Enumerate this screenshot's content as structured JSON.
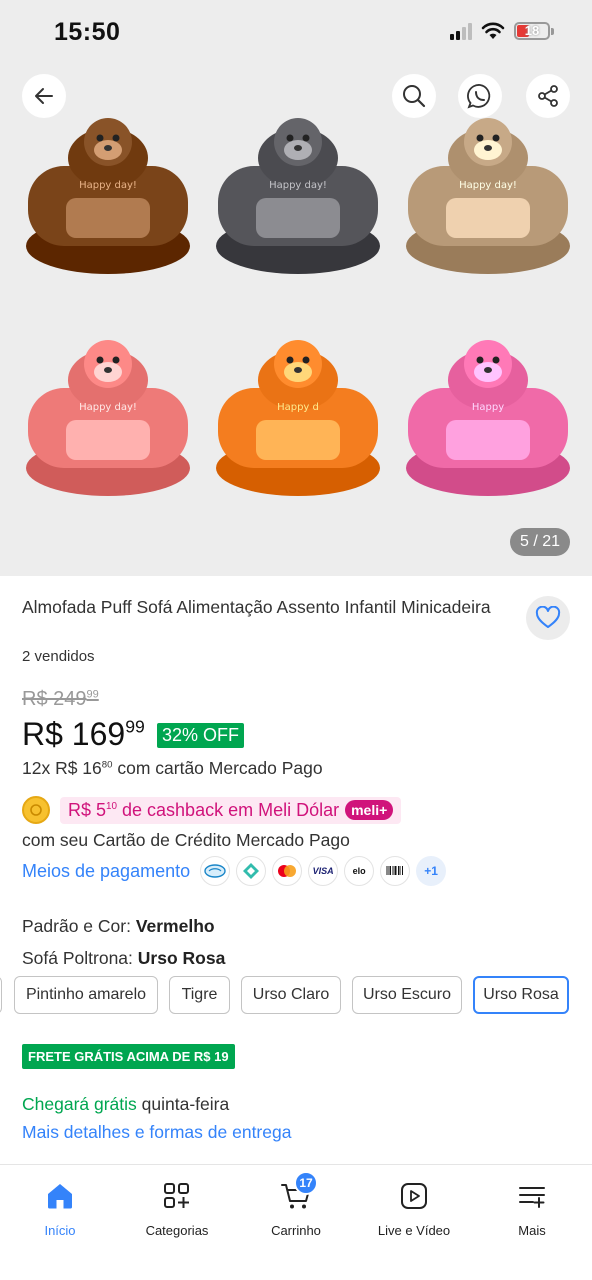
{
  "status_bar": {
    "time": "15:50",
    "battery": "18"
  },
  "gallery": {
    "counter": "5 / 21",
    "seat_colors": [
      "#7a4419",
      "#55555a",
      "#b89a78",
      "#ee7a78",
      "#f47d1f",
      "#f06aa8"
    ],
    "seat_text": [
      "Happy day!",
      "Happy day!",
      "Happy day!",
      "Happy day!",
      "Happy d",
      "Happy"
    ]
  },
  "product": {
    "title": "Almofada Puff Sofá Alimentação Assento Infantil Minicadeira",
    "sold": "2 vendidos",
    "old_price_main": "R$ 249",
    "old_price_cents": "99",
    "price_main": "R$ 169",
    "price_cents": "99",
    "discount": "32% OFF",
    "installments_prefix": "12x R$ 16",
    "installments_cents": "80",
    "installments_suffix": " com cartão Mercado Pago",
    "cashback_prefix": "R$ 5",
    "cashback_cents": "10",
    "cashback_suffix": " de cashback em Meli Dólar",
    "cashback_badge": "meli+",
    "cashback_sub": "com seu Cartão de Crédito Mercado Pago",
    "payments_link": "Meios de pagamento",
    "payment_icons": [
      "mercadopago-icon",
      "pix-icon",
      "mastercard-icon",
      "visa-icon",
      "elo-icon",
      "boleto-icon"
    ],
    "payments_more": "+1"
  },
  "variants": {
    "color_label": "Padrão e Cor: ",
    "color_value": "Vermelho",
    "model_label": "Sofá Poltrona: ",
    "model_value": "Urso Rosa",
    "chips": [
      "Pintinho amarelo",
      "Tigre",
      "Urso Claro",
      "Urso Escuro",
      "Urso Rosa"
    ],
    "selected": "Urso Rosa"
  },
  "shipping": {
    "badge": "FRETE GRÁTIS ACIMA DE R$ 19",
    "arrival_green": "Chegará grátis",
    "arrival_rest": " quinta-feira",
    "details_link": "Mais detalhes e formas de entrega"
  },
  "nav": {
    "items": [
      "Início",
      "Categorias",
      "Carrinho",
      "Live e Vídeo",
      "Mais"
    ],
    "cart_count": "17",
    "active": "Início"
  },
  "colors": {
    "accent": "#3483fa",
    "green": "#00a650",
    "pink": "#d0137b"
  }
}
